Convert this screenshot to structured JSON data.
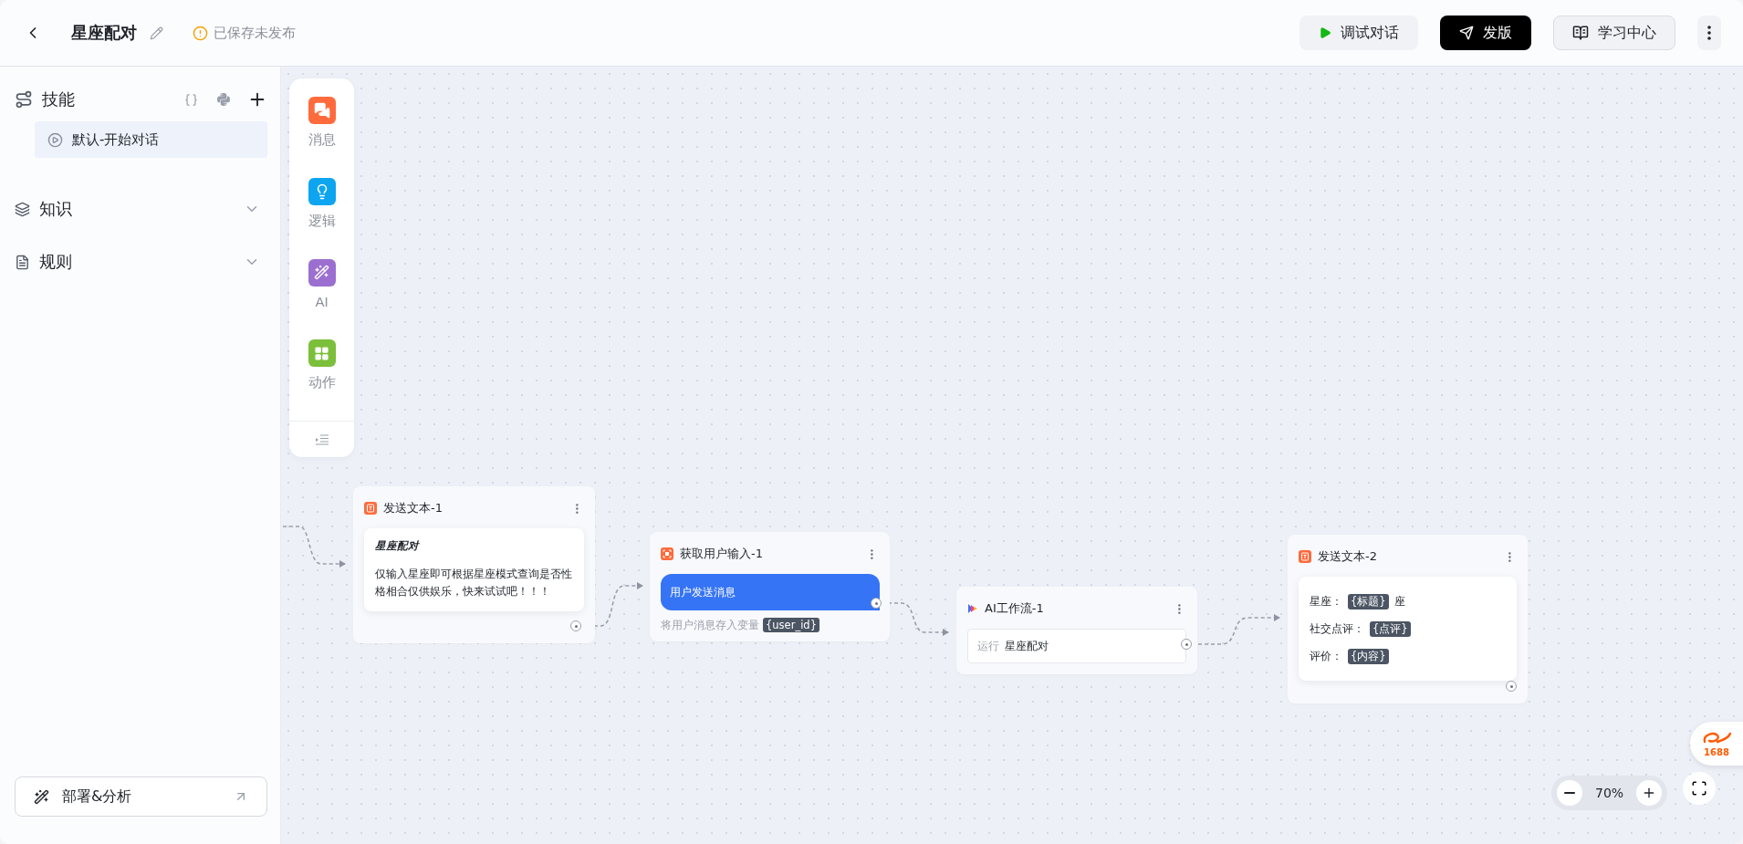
{
  "header": {
    "title": "星座配对",
    "status": "已保存未发布",
    "buttons": [
      {
        "kind": "debug",
        "label": "调试对话"
      },
      {
        "kind": "publish",
        "label": "发版"
      },
      {
        "kind": "learn",
        "label": "学习中心"
      },
      {
        "kind": "more"
      }
    ]
  },
  "sidebar": {
    "sections": [
      {
        "kind": "skills",
        "title": "技能",
        "children": [
          {
            "label": "默认-开始对话",
            "selected": true
          }
        ]
      },
      {
        "kind": "knowledge",
        "title": "知识"
      },
      {
        "kind": "rules",
        "title": "规则"
      }
    ],
    "deploy_button": "部署&分析"
  },
  "palette": {
    "items": [
      {
        "kind": "message",
        "label": "消息"
      },
      {
        "kind": "logic",
        "label": "逻辑"
      },
      {
        "kind": "ai",
        "label": "AI"
      },
      {
        "kind": "action",
        "label": "动作"
      }
    ]
  },
  "nodes": [
    {
      "kind": "send_text",
      "title": "发送文本-1",
      "heading": "星座配对",
      "text": "仅输入星座即可根据星座模式查询是否性格相合仅供娱乐，快来试试吧！！！"
    },
    {
      "kind": "user_input",
      "title": "获取用户输入-1",
      "bubble": "用户发送消息",
      "hint": "将用户消息存入变量",
      "variable": "{user_id}"
    },
    {
      "kind": "ai_workflow",
      "title": "AI工作流-1",
      "run_label": "运行",
      "run_value": "星座配对"
    },
    {
      "kind": "send_fields",
      "title": "发送文本-2",
      "fields": [
        {
          "label": "星座：",
          "variable": "{标题}",
          "suffix": "座"
        },
        {
          "label": "社交点评：",
          "variable": "{点评}"
        },
        {
          "label": "评价：",
          "variable": "{内容}"
        }
      ]
    }
  ],
  "zoom": {
    "value": "70%"
  },
  "badge": "1688"
}
